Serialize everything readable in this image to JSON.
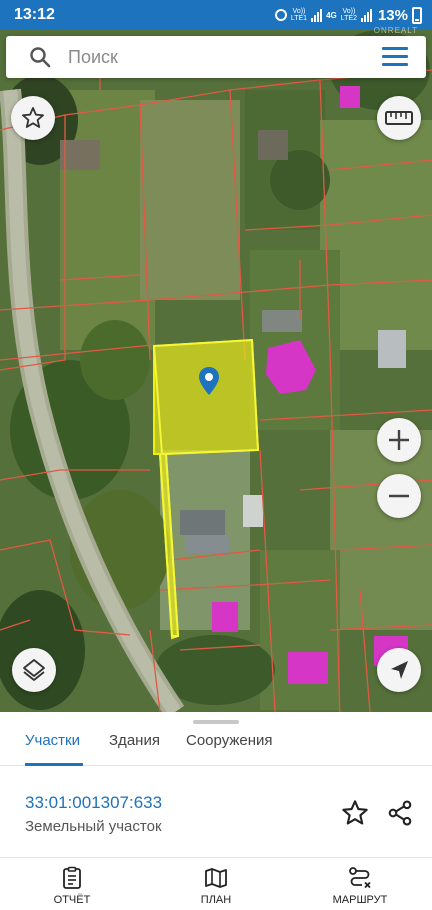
{
  "status_bar": {
    "time": "13:12",
    "network_1": "Vo))",
    "network_1_sub": "LTE1",
    "network_type": "4G",
    "network_2": "Vo))",
    "network_2_sub": "LTE2",
    "battery": "13%"
  },
  "search": {
    "placeholder": "Поиск"
  },
  "watermark": "ONREALT",
  "map": {
    "parcel_highlight_color": "#e5e51d",
    "parcel_border_color": "#c8c800",
    "marker_color": "#1e73be",
    "boundary_color": "#e05a44",
    "building_color": "#d636c6",
    "controls": [
      "favorite-star",
      "ruler",
      "zoom-in",
      "zoom-out",
      "layers",
      "my-location"
    ]
  },
  "tabs": [
    {
      "label": "Участки",
      "active": true
    },
    {
      "label": "Здания",
      "active": false
    },
    {
      "label": "Сооружения",
      "active": false
    }
  ],
  "parcel": {
    "number": "33:01:001307:633",
    "type": "Земельный участок"
  },
  "bottom_nav": [
    {
      "label": "ОТЧЁТ",
      "icon": "report-icon"
    },
    {
      "label": "ПЛАН",
      "icon": "map-plan-icon"
    },
    {
      "label": "МАРШРУТ",
      "icon": "route-icon"
    }
  ],
  "colors": {
    "accent": "#1e73be",
    "text_secondary": "#555555"
  }
}
